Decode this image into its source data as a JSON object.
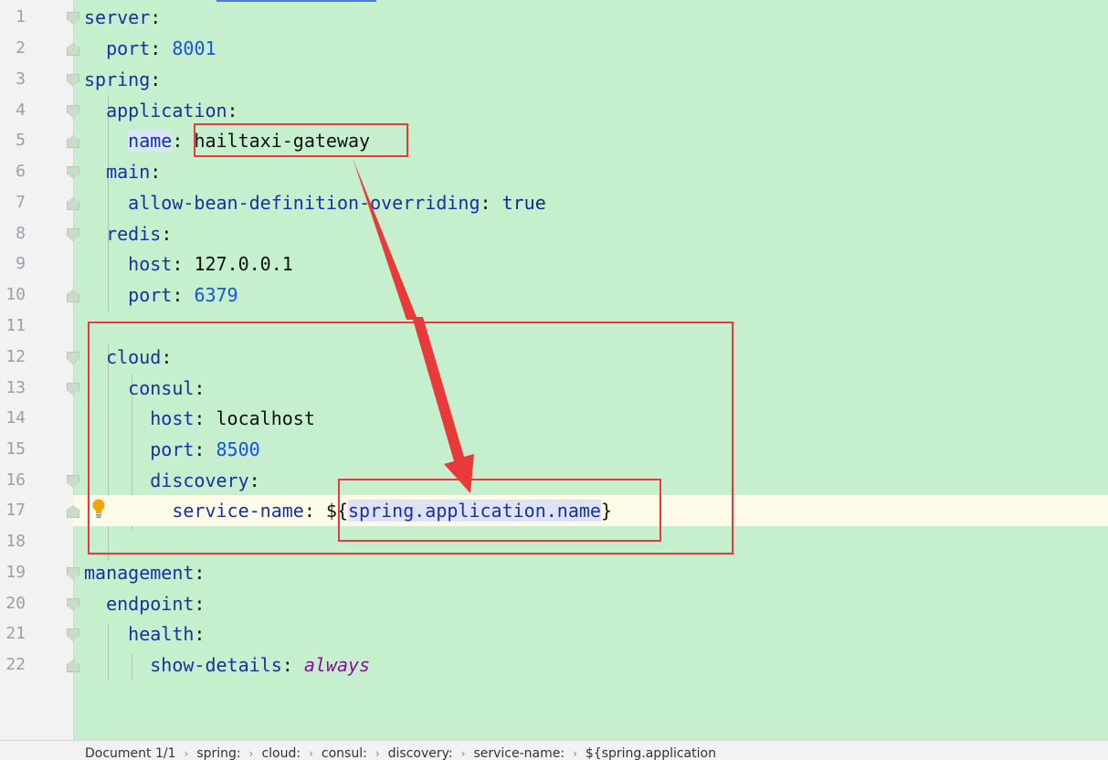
{
  "editor": {
    "line_numbers": [
      "1",
      "2",
      "3",
      "4",
      "5",
      "6",
      "7",
      "8",
      "9",
      "10",
      "11",
      "12",
      "13",
      "14",
      "15",
      "16",
      "17",
      "18",
      "19",
      "20",
      "21",
      "22"
    ],
    "lines": {
      "l1_key": "server",
      "colon": ":",
      "l2_key": "port",
      "l2_val": "8001",
      "l3_key": "spring",
      "l4_key": "application",
      "l5_key": "name",
      "l5_val": "hailtaxi-gateway",
      "l6_key": "main",
      "l7_key": "allow-bean-definition-overriding",
      "l7_val": "true",
      "l8_key": "redis",
      "l9_key": "host",
      "l9_val": "127.0.0.1",
      "l10_key": "port",
      "l10_val": "6379",
      "l12_key": "cloud",
      "l13_key": "consul",
      "l14_key": "host",
      "l14_val": "localhost",
      "l15_key": "port",
      "l15_val": "8500",
      "l16_key": "discovery",
      "l17_key": "service-name",
      "l17_open": "${",
      "l17_ref": "spring.application.name",
      "l17_close": "}",
      "l19_key": "management",
      "l20_key": "endpoint",
      "l21_key": "health",
      "l22_key": "show-details",
      "l22_val": "always"
    }
  },
  "statusbar": {
    "breadcrumbs": [
      "Document 1/1",
      "spring:",
      "cloud:",
      "consul:",
      "discovery:",
      "service-name:",
      "${spring.application"
    ]
  },
  "colors": {
    "background": "#c6efce",
    "annotation_red": "#e83a3a",
    "keyword_blue": "#1a2fa0",
    "number_blue": "#1750eb",
    "italic_purple": "#871094"
  }
}
